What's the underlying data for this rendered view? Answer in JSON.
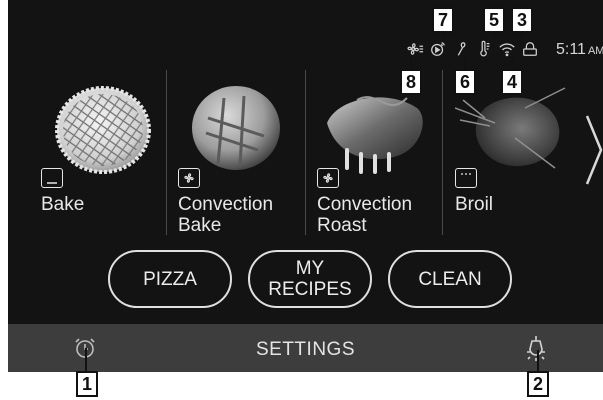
{
  "status_bar": {
    "icons": [
      "convection-fan-icon",
      "remote-start-icon",
      "probe-icon",
      "thermometer-icon",
      "wifi-icon",
      "lock-icon"
    ],
    "time": "5:11",
    "ampm": "AM"
  },
  "modes": [
    {
      "label": "Bake",
      "icon": "bake-icon"
    },
    {
      "label": "Convection\nBake",
      "icon": "convection-fan-icon"
    },
    {
      "label": "Convection\nRoast",
      "icon": "convection-fan-icon"
    },
    {
      "label": "Broil",
      "icon": "broil-icon"
    }
  ],
  "buttons": {
    "pizza": "PIZZA",
    "my_recipes": "MY\nRECIPES",
    "clean": "CLEAN"
  },
  "bottom_bar": {
    "settings": "SETTINGS",
    "left_icon": "alarm-clock-icon",
    "right_icon": "oven-light-icon"
  },
  "callouts": {
    "c1": "1",
    "c2": "2",
    "c3": "3",
    "c4": "4",
    "c5": "5",
    "c6": "6",
    "c7": "7",
    "c8": "8"
  }
}
